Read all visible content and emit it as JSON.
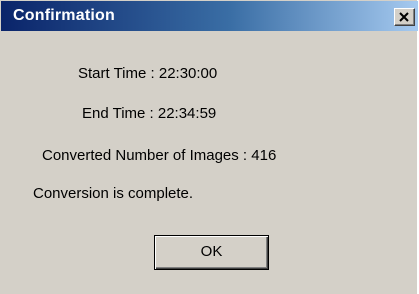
{
  "window": {
    "title": "Confirmation"
  },
  "dialog": {
    "start_time": "Start Time : 22:30:00",
    "end_time": "End Time : 22:34:59",
    "converted_count": "Converted Number of Images : 416",
    "message": "Conversion is complete.",
    "ok_label": "OK"
  },
  "icons": {
    "close": "close-icon"
  },
  "colors": {
    "title_bar_start": "#0a246a",
    "title_bar_end": "#a6caf0",
    "dialog_background": "#d4d0c8"
  }
}
